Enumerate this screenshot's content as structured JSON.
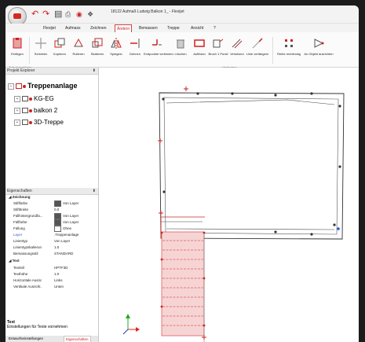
{
  "window": {
    "title": "18122 Aufmaß Ludwig Balkon 1_ - Flexijet"
  },
  "quick_access": {
    "undo_icon": "undo-icon",
    "redo_icon": "redo-icon",
    "save_icon": "save-icon"
  },
  "menu": {
    "tabs": [
      {
        "label": "Flexijet"
      },
      {
        "label": "Aufmass"
      },
      {
        "label": "Zeichnen"
      },
      {
        "label": "Ändern"
      },
      {
        "label": "Bemassen"
      },
      {
        "label": "Treppe"
      },
      {
        "label": "Ansicht"
      },
      {
        "label": "?"
      }
    ],
    "active": "Ändern"
  },
  "ribbon": {
    "buttons": [
      {
        "label": "Einfügen"
      },
      {
        "label": "Schieben"
      },
      {
        "label": "Kopieren"
      },
      {
        "label": "Rotieren"
      },
      {
        "label": "Skalieren"
      },
      {
        "label": "Spiegeln"
      },
      {
        "label": "Dehnen"
      },
      {
        "label": "Endpunkte verbinden"
      },
      {
        "label": "Löschen"
      },
      {
        "label": "Auflösen"
      },
      {
        "label": "Bruch 1 Punkt"
      },
      {
        "label": "Versetzen"
      },
      {
        "label": "Linie verlängern"
      },
      {
        "label": "Reihe rechteckig"
      },
      {
        "label": "An Objekt ausrichten"
      }
    ],
    "groups": {
      "clipboard": "Zwischenablage",
      "modify": "Verändern"
    }
  },
  "project_explorer": {
    "title": "Projekt Explorer",
    "root": "Treppenanlage",
    "children": [
      {
        "label": "KG-EG"
      },
      {
        "label": "balkon 2"
      },
      {
        "label": "3D-Treppe"
      }
    ]
  },
  "properties": {
    "title": "Eigenschaften",
    "sections": {
      "drawing": "Zeichnung",
      "text": "Text"
    },
    "drawing_rows": [
      {
        "key": "Stiftfarbe",
        "value": "Von Layer",
        "swatch": "#555555"
      },
      {
        "key": "Stiftbreite",
        "value": "0.0"
      },
      {
        "key": "Füllhintergrundfa...",
        "value": "Von Layer",
        "swatch": "#555555"
      },
      {
        "key": "Füllfarbe",
        "value": "Von Layer",
        "swatch": "#555555"
      },
      {
        "key": "Füllung",
        "value": "Ohne",
        "swatch": "#ffffff"
      },
      {
        "key": "Layer",
        "value": ".Treppenanlage",
        "accent": "#3a5fcd"
      },
      {
        "key": "Linientyp",
        "value": "Von Layer"
      },
      {
        "key": "Linientypskalierun",
        "value": "1.0"
      },
      {
        "key": "Bemassungsstil",
        "value": "STANDARD"
      }
    ],
    "text_rows": [
      {
        "key": "Textstil",
        "value": "HPTF3D"
      },
      {
        "key": "Texthöhe",
        "value": "1.0"
      },
      {
        "key": "Horizontale Ausric",
        "value": "Links"
      },
      {
        "key": "Vertikale Ausricht.",
        "value": "Unten"
      }
    ],
    "description_title": "Text",
    "description": "Einstellungen für Texte vornehmen"
  },
  "bottom_tabs": [
    {
      "label": "Entwurfseinstellungen"
    },
    {
      "label": "Eigenschaften"
    }
  ],
  "colors": {
    "accent": "#cc2222",
    "stair_fill": "#f6d4d4",
    "stair_line": "#e05a5a",
    "axis_x": "#d22",
    "axis_y": "#2a2",
    "axis_z": "#23c"
  }
}
